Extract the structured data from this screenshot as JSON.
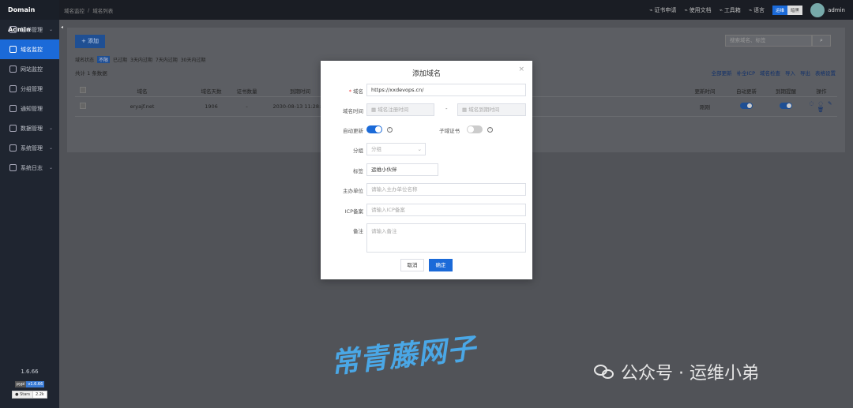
{
  "brand": "Domain Admin",
  "sidebar": {
    "items": [
      {
        "label": "证书管理",
        "has_chevron": true,
        "active": false,
        "icon": "certificate-icon"
      },
      {
        "label": "域名监控",
        "has_chevron": false,
        "active": true,
        "icon": "monitor-icon"
      },
      {
        "label": "网站监控",
        "has_chevron": false,
        "active": false,
        "icon": "website-icon"
      },
      {
        "label": "分组管理",
        "has_chevron": false,
        "active": false,
        "icon": "group-icon"
      },
      {
        "label": "通知管理",
        "has_chevron": false,
        "active": false,
        "icon": "notify-icon"
      },
      {
        "label": "数据管理",
        "has_chevron": true,
        "active": false,
        "icon": "data-icon"
      },
      {
        "label": "系统管理",
        "has_chevron": true,
        "active": false,
        "icon": "settings-icon"
      },
      {
        "label": "系统日志",
        "has_chevron": true,
        "active": false,
        "icon": "log-icon"
      }
    ],
    "version": "1.6.66",
    "badge_left": "pypi",
    "badge_right": "v1.6.66",
    "github_label": "Stars",
    "github_count": "2.2k"
  },
  "topbar": {
    "breadcrumb": [
      "域名监控",
      "域名列表"
    ],
    "nav": [
      {
        "label": "证书申请",
        "icon": "link-icon"
      },
      {
        "label": "使用文档",
        "icon": "link-icon"
      },
      {
        "label": "工具箱",
        "icon": "toolbox-icon"
      },
      {
        "label": "语言",
        "icon": "language-icon"
      }
    ],
    "theme_on": "运维",
    "theme_off": "暗黑",
    "username": "admin"
  },
  "content": {
    "add_button": "+ 添加",
    "search_placeholder": "搜索域名、标签",
    "filter_label": "域名状态",
    "filters": [
      "不限",
      "已过期",
      "3天内过期",
      "7天内过期",
      "30天内过期"
    ],
    "total": "共计 1 条数据",
    "actions": [
      "全部更新",
      "补全ICP",
      "域名检查",
      "导入",
      "导出",
      "表格设置"
    ],
    "columns": [
      "域名",
      "域名天数",
      "证书数量",
      "到期时间",
      "",
      "更新时间",
      "自动更新",
      "到期提醒",
      "操作"
    ],
    "row": {
      "domain": "eryajf.net",
      "days": "1906",
      "certs": "-",
      "expire": "2030-08-13 11:28:15",
      "updated": "刚刚",
      "ops": "◌ ◌ ✎ 🗑"
    }
  },
  "modal": {
    "title": "添加域名",
    "domain_label": "域名",
    "domain_value": "https://xxdevops.cn/",
    "time_label": "域名时间",
    "start_placeholder": "域名注册时间",
    "end_placeholder": "域名到期时间",
    "time_sep": "-",
    "auto_update_label": "自动更新",
    "auto_update_on": true,
    "sub_cert_label": "子域证书",
    "sub_cert_on": false,
    "group_label": "分组",
    "group_placeholder": "分组",
    "tag_label": "标签",
    "tag_value": "运维小伙伴",
    "org_label": "主办单位",
    "org_placeholder": "请输入主办单位名称",
    "icp_label": "ICP备案",
    "icp_placeholder": "请输入ICP备案",
    "remark_label": "备注",
    "remark_placeholder": "请输入备注",
    "cancel": "取消",
    "confirm": "确定"
  },
  "watermark": {
    "text": "常青藤网子",
    "wechat": "公众号 · 运维小弟"
  },
  "colors": {
    "primary": "#1b6ad8",
    "sidebar": "#1f2530",
    "topbar": "#1a1d24"
  }
}
